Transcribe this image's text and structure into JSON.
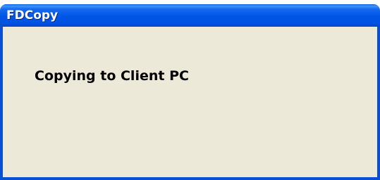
{
  "window": {
    "title": "FDCopy"
  },
  "dialog": {
    "message": "Copying to Client PC"
  },
  "colors": {
    "titlebar": "#0055e5",
    "client_background": "#ece9d8",
    "title_text": "#ffffff",
    "message_text": "#000000"
  }
}
